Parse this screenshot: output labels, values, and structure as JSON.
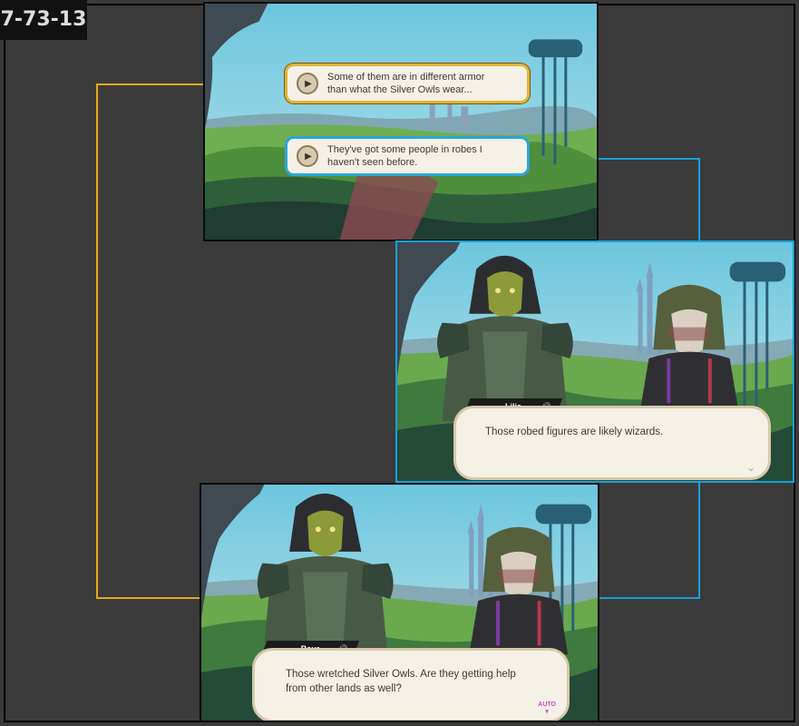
{
  "id_tag": "7-73-13",
  "panel1": {
    "choices": [
      {
        "line1": "Some of them are in different armor",
        "line2": "than what the Silver Owls wear..."
      },
      {
        "line1": "They've got some people in robes I",
        "line2": "haven't seen before."
      }
    ]
  },
  "panel2": {
    "speaker": "Lilia",
    "text": "Those robed figures are likely wizards.",
    "continue_icon": "chevron-down-icon"
  },
  "panel3": {
    "speaker": "Baur",
    "line1": "Those wretched Silver Owls. Are they getting help",
    "line2": "from other lands as well?",
    "auto_label": "AUTO"
  },
  "colors": {
    "connector_yellow": "#e6a91a",
    "connector_blue": "#1aa0d8",
    "dialog_bg": "#f6f1e6"
  }
}
